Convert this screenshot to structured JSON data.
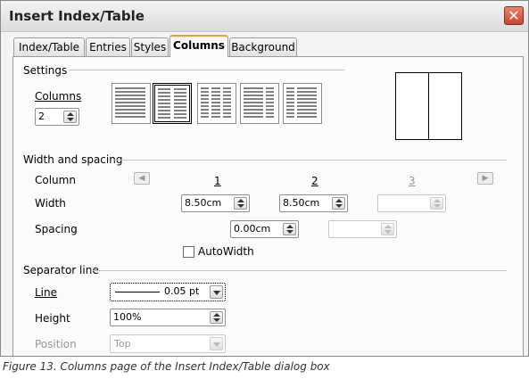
{
  "dialog": {
    "title": "Insert Index/Table",
    "close_glyph": "✕"
  },
  "tabs": [
    {
      "label": "Index/Table",
      "active": false
    },
    {
      "label": "Entries",
      "active": false
    },
    {
      "label": "Styles",
      "active": false
    },
    {
      "label": "Columns",
      "active": true
    },
    {
      "label": "Background",
      "active": false
    }
  ],
  "settings": {
    "section_label": "Settings",
    "columns_label": "Columns",
    "columns_value": "2",
    "presets": [
      {
        "columns": 1,
        "selected": false
      },
      {
        "columns": 2,
        "selected": true
      },
      {
        "columns": 3,
        "selected": false
      },
      {
        "columns": 2,
        "layout": "wide-left",
        "selected": false
      },
      {
        "columns": 2,
        "layout": "wide-right",
        "selected": false
      }
    ]
  },
  "width_spacing": {
    "section_label": "Width and spacing",
    "column_label": "Column",
    "width_label": "Width",
    "spacing_label": "Spacing",
    "column_numbers": [
      "1",
      "2",
      "3"
    ],
    "widths": [
      "8.50cm",
      "8.50cm",
      ""
    ],
    "spacings": [
      "0.00cm",
      ""
    ],
    "autowidth_label": "AutoWidth",
    "autowidth_checked": false,
    "left_arrow_icon": "arrow-left-icon",
    "right_arrow_icon": "arrow-right-icon"
  },
  "separator": {
    "section_label": "Separator line",
    "line_label": "Line",
    "line_value": "0.05 pt",
    "height_label": "Height",
    "height_value": "100%",
    "position_label": "Position",
    "position_value": "Top"
  },
  "caption": "Figure 13. Columns page of the Insert Index/Table dialog box"
}
